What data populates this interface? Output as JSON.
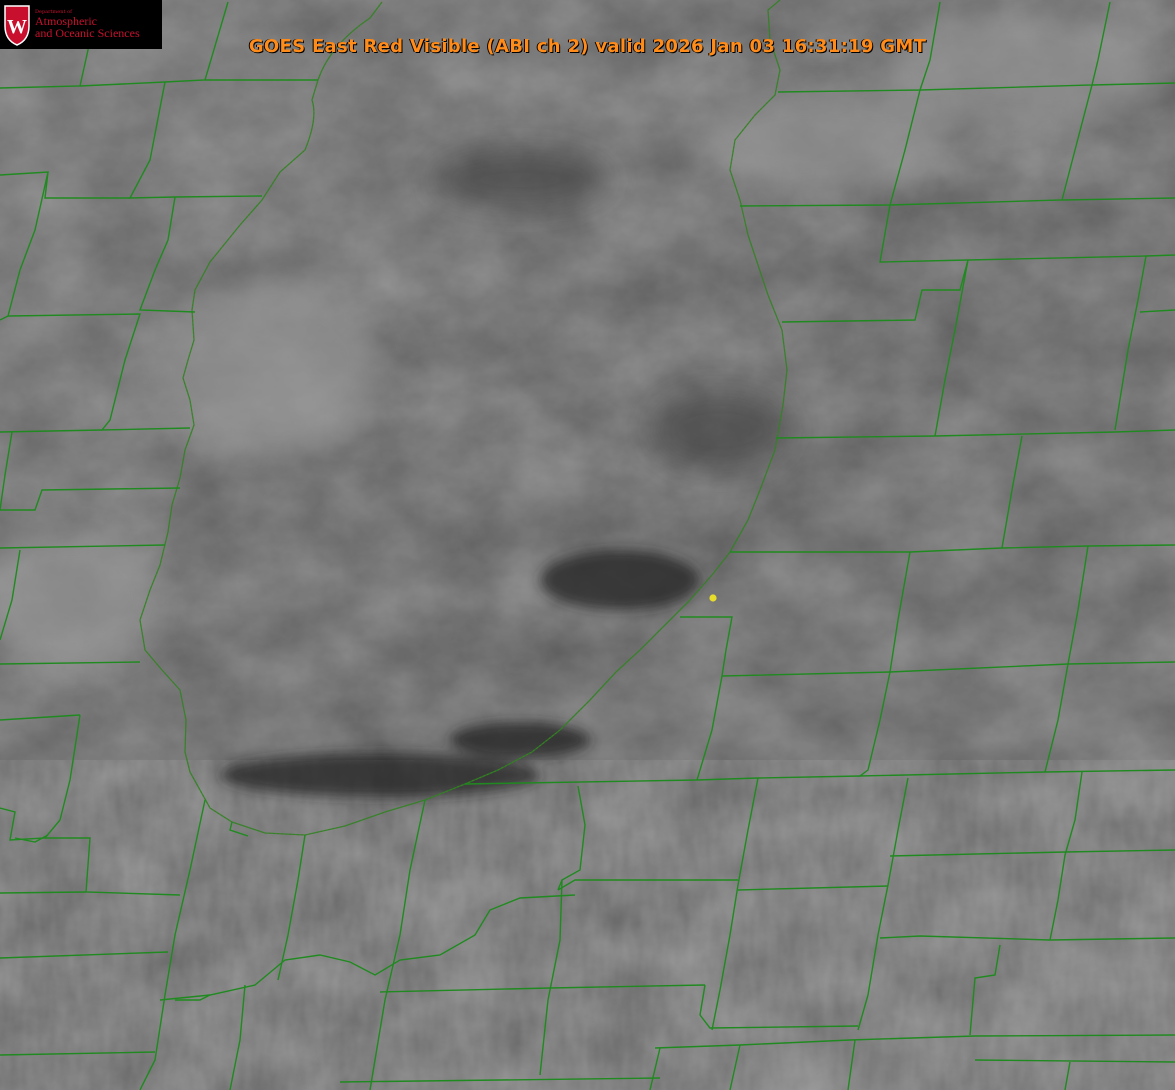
{
  "title": "GOES East Red Visible (ABI ch 2) valid 2026 Jan 03 16:31:19 GMT",
  "logo": {
    "seal_letter": "W",
    "department": "Department of",
    "line1": "Atmospheric",
    "line2": "and Oceanic Sciences"
  },
  "colors": {
    "county_lines": "#1f8a1f",
    "shoreline": "#d64040",
    "marker": "#e6dc2a",
    "title": "#ff8c1a",
    "logo_text": "#c8102e"
  },
  "icons": [
    "uw-crest-icon",
    "location-marker-icon"
  ]
}
